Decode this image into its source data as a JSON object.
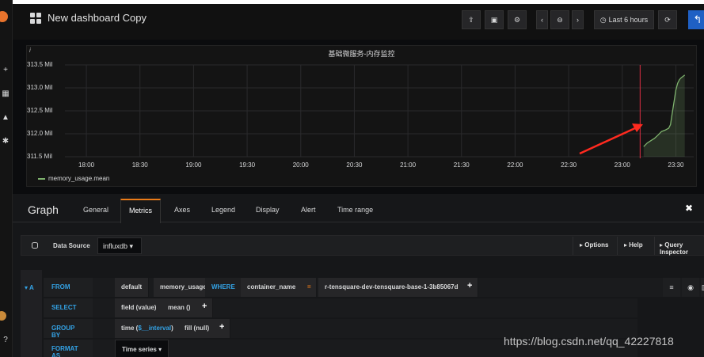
{
  "topbar": {
    "title": "New dashboard Copy",
    "time_range": "Last 6 hours"
  },
  "panel": {
    "title": "基础微服务-内存监控",
    "info_marker": "i",
    "legend_series": "memory_usage.mean",
    "series_color": "#7eb26d",
    "alert_line_color": "#e02f44",
    "annotation_arrow_color": "#ff2a1f"
  },
  "chart_data": {
    "type": "line",
    "title": "基础微服务-内存监控",
    "xlabel": "",
    "ylabel": "",
    "x_ticks": [
      "18:00",
      "18:30",
      "19:00",
      "19:30",
      "20:00",
      "20:30",
      "21:00",
      "21:30",
      "22:00",
      "22:30",
      "23:00",
      "23:30"
    ],
    "y_ticks": [
      "313.5 Mil",
      "313.0 Mil",
      "312.5 Mil",
      "312.0 Mil",
      "311.5 Mil"
    ],
    "ylim": [
      311.5,
      313.5
    ],
    "grid": true,
    "legend": "bottom-left",
    "series": [
      {
        "name": "memory_usage.mean",
        "x": [
          "23:12",
          "23:14",
          "23:16",
          "23:18",
          "23:20",
          "23:22",
          "23:24",
          "23:26",
          "23:27",
          "23:28",
          "23:29",
          "23:30",
          "23:31",
          "23:32",
          "23:33",
          "23:34",
          "23:35"
        ],
        "values": [
          311.72,
          311.8,
          311.85,
          311.9,
          311.97,
          312.05,
          312.08,
          312.12,
          312.2,
          312.45,
          312.7,
          312.95,
          313.1,
          313.18,
          313.22,
          313.25,
          313.28
        ]
      }
    ]
  },
  "editor": {
    "title": "Graph",
    "tabs": [
      "General",
      "Metrics",
      "Axes",
      "Legend",
      "Display",
      "Alert",
      "Time range"
    ],
    "active_tab": "Metrics",
    "close": "✖",
    "datasource_label": "Data Source",
    "datasource_value": "influxdb",
    "options_label": "Options",
    "help_label": "Help",
    "inspector_label": "Query Inspector"
  },
  "query": {
    "ref_id": "A",
    "from_kw": "FROM",
    "from_policy": "default",
    "from_measurement": "memory_usage",
    "where_kw": "WHERE",
    "where_key": "container_name",
    "where_op": "=",
    "where_value": "r-tensquare-dev-tensquare-base-1-3b85067d",
    "select_kw": "SELECT",
    "select_field": "field (value)",
    "select_fn": "mean ()",
    "groupby_kw": "GROUP BY",
    "groupby_time_prefix": "time (",
    "groupby_time_var": "$__interval",
    "groupby_time_suffix": ")",
    "groupby_fill": "fill (null)",
    "format_kw": "FORMAT AS",
    "format_value": "Time series",
    "plus": "+"
  },
  "watermark": "https://blog.csdn.net/qq_42227818"
}
